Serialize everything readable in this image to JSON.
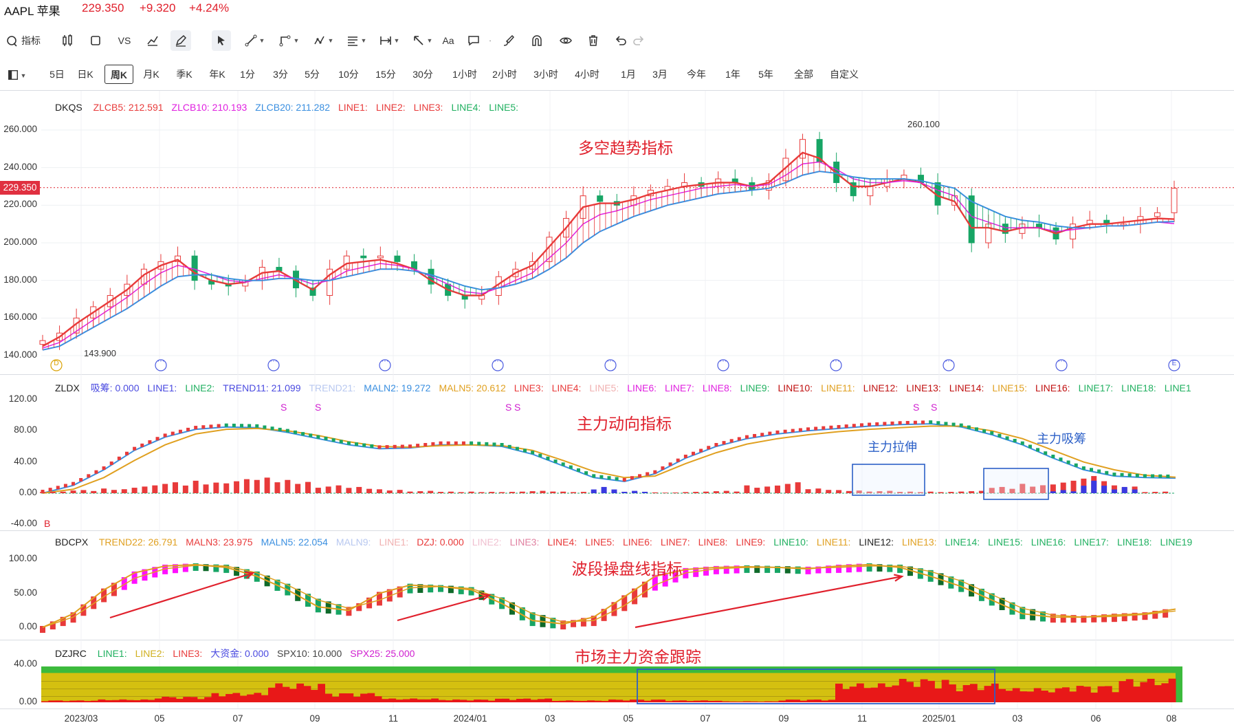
{
  "header": {
    "symbol": "AAPL 苹果",
    "price": "229.350",
    "change": "+9.320",
    "change_pct": "+4.24%",
    "up_color": "#e0202c"
  },
  "toolbar": {
    "indicator_label": "指标",
    "vs_label": "VS",
    "text_tool_label": "Aa",
    "tools": [
      "indicator-icon",
      "bar-chart-icon",
      "rectangle-icon",
      "vs",
      "compare-chart-icon",
      "pen-icon",
      "cursor-icon",
      "line-tool-icon",
      "shape-tool-icon",
      "pattern-tool-icon",
      "text-tool-icon",
      "measure-tool-icon",
      "arrow-tool-icon",
      "text-tool",
      "comment-icon",
      "brush-icon",
      "magnet-icon",
      "eye-icon",
      "trash-icon",
      "undo-icon",
      "redo-icon"
    ]
  },
  "periods": [
    "5日",
    "日K",
    "周K",
    "月K",
    "季K",
    "年K",
    "1分",
    "3分",
    "5分",
    "10分",
    "15分",
    "30分",
    "1小时",
    "2小时",
    "3小时",
    "4小时",
    "1月",
    "3月",
    "今年",
    "1年",
    "5年",
    "全部",
    "自定义"
  ],
  "selected_period": "周K",
  "main_panel": {
    "indicator_name": "DKQS",
    "legend": [
      {
        "text": "ZLCB5: 212.591",
        "color": "#e83a3a"
      },
      {
        "text": "ZLCB10: 210.193",
        "color": "#e020e0"
      },
      {
        "text": "ZLCB20: 211.282",
        "color": "#3a8fe0"
      },
      {
        "text": "LINE1:",
        "color": "#e83a3a"
      },
      {
        "text": "LINE2:",
        "color": "#e83a3a"
      },
      {
        "text": "LINE3:",
        "color": "#e83a3a"
      },
      {
        "text": "LINE4:",
        "color": "#20b060"
      },
      {
        "text": "LINE5:",
        "color": "#20b060"
      }
    ],
    "title": "多空趋势指标",
    "yticks": [
      "260.000",
      "240.000",
      "220.000",
      "200.000",
      "180.000",
      "160.000",
      "140.000"
    ],
    "last_price": "229.350",
    "high_label": "260.100",
    "low_label": "143.900",
    "event_markers": [
      "D",
      "···",
      "···",
      "···",
      "···",
      "···",
      "···",
      "···",
      "···",
      "···",
      "E"
    ]
  },
  "zldx_panel": {
    "indicator_name": "ZLDX",
    "legend": [
      {
        "text": "吸筹: 0.000",
        "color": "#4a4ae0"
      },
      {
        "text": "LINE1:",
        "color": "#4a4ae0"
      },
      {
        "text": "LINE2:",
        "color": "#20b060"
      },
      {
        "text": "TREND11: 21.099",
        "color": "#4a4ae0"
      },
      {
        "text": "TREND21:",
        "color": "#b8c8f0"
      },
      {
        "text": "MALN2: 19.272",
        "color": "#3a8fe0"
      },
      {
        "text": "MALN5: 20.612",
        "color": "#e0a020"
      },
      {
        "text": "LINE3:",
        "color": "#e83a3a"
      },
      {
        "text": "LINE4:",
        "color": "#e83a3a"
      },
      {
        "text": "LINE5:",
        "color": "#f0b0b0"
      },
      {
        "text": "LINE6:",
        "color": "#e020e0"
      },
      {
        "text": "LINE7:",
        "color": "#e020e0"
      },
      {
        "text": "LINE8:",
        "color": "#e020e0"
      },
      {
        "text": "LINE9:",
        "color": "#20b060"
      },
      {
        "text": "LINE10:",
        "color": "#c01010"
      },
      {
        "text": "LINE11:",
        "color": "#e0a020"
      },
      {
        "text": "LINE12:",
        "color": "#c01010"
      },
      {
        "text": "LINE13:",
        "color": "#c01010"
      },
      {
        "text": "LINE14:",
        "color": "#c01010"
      },
      {
        "text": "LINE15:",
        "color": "#e0a020"
      },
      {
        "text": "LINE16:",
        "color": "#c01010"
      },
      {
        "text": "LINE17:",
        "color": "#20b060"
      },
      {
        "text": "LINE18:",
        "color": "#20b060"
      },
      {
        "text": "LINE1",
        "color": "#20b060"
      }
    ],
    "title": "主力动向指标",
    "yticks": [
      "120.00",
      "80.00",
      "40.00",
      "0.00",
      "-40.00"
    ],
    "b_marker": "B",
    "s_markers": [
      "S",
      "S",
      "S",
      "S",
      "S",
      "S"
    ],
    "annot_pull": "主力拉伸",
    "annot_absorb": "主力吸筹"
  },
  "bdcpx_panel": {
    "indicator_name": "BDCPX",
    "legend": [
      {
        "text": "TREND22: 26.791",
        "color": "#e0a020"
      },
      {
        "text": "MALN3: 23.975",
        "color": "#e83a3a"
      },
      {
        "text": "MALN5: 22.054",
        "color": "#3a8fe0"
      },
      {
        "text": "MALN9:",
        "color": "#b8c8f0"
      },
      {
        "text": "LINE1:",
        "color": "#f0b0b0"
      },
      {
        "text": "DZJ: 0.000",
        "color": "#e83a3a"
      },
      {
        "text": "LINE2:",
        "color": "#f0c0d0"
      },
      {
        "text": "LINE3:",
        "color": "#e080a0"
      },
      {
        "text": "LINE4:",
        "color": "#e83a3a"
      },
      {
        "text": "LINE5:",
        "color": "#e83a3a"
      },
      {
        "text": "LINE6:",
        "color": "#e83a3a"
      },
      {
        "text": "LINE7:",
        "color": "#e83a3a"
      },
      {
        "text": "LINE8:",
        "color": "#e83a3a"
      },
      {
        "text": "LINE9:",
        "color": "#e83a3a"
      },
      {
        "text": "LINE10:",
        "color": "#20b060"
      },
      {
        "text": "LINE11:",
        "color": "#e0a020"
      },
      {
        "text": "LINE12:",
        "color": "#222222"
      },
      {
        "text": "LINE13:",
        "color": "#e0a020"
      },
      {
        "text": "LINE14:",
        "color": "#20b060"
      },
      {
        "text": "LINE15:",
        "color": "#20b060"
      },
      {
        "text": "LINE16:",
        "color": "#20b060"
      },
      {
        "text": "LINE17:",
        "color": "#20b060"
      },
      {
        "text": "LINE18:",
        "color": "#20b060"
      },
      {
        "text": "LINE19",
        "color": "#20b060"
      }
    ],
    "title": "波段操盘线指标",
    "yticks": [
      "100.00",
      "50.00",
      "0.00"
    ]
  },
  "dzjrc_panel": {
    "indicator_name": "DZJRC",
    "legend": [
      {
        "text": "LINE1:",
        "color": "#20b060"
      },
      {
        "text": "LINE2:",
        "color": "#d0b020"
      },
      {
        "text": "LINE3:",
        "color": "#e83a3a"
      },
      {
        "text": "大资金: 0.000",
        "color": "#4a4ae0"
      },
      {
        "text": "SPX10: 10.000",
        "color": "#444444"
      },
      {
        "text": "SPX25: 25.000",
        "color": "#d020d0"
      }
    ],
    "title": "市场主力资金跟踪",
    "yticks": [
      "40.00",
      "0.00"
    ]
  },
  "xaxis": [
    "2023/03",
    "05",
    "07",
    "09",
    "11",
    "2024/01",
    "03",
    "05",
    "07",
    "09",
    "11",
    "2025/01",
    "03",
    "06",
    "08"
  ],
  "chart_data": [
    {
      "type": "candlestick",
      "title": "多空趋势指标",
      "ylim": [
        140,
        265
      ],
      "y_high_marked": 260.1,
      "y_low_marked": 143.9,
      "last": 229.35,
      "x": [
        "2023/03",
        "05",
        "07",
        "09",
        "11",
        "2024/01",
        "03",
        "05",
        "07",
        "09",
        "11",
        "2025/01",
        "03",
        "06",
        "08"
      ],
      "close_path": [
        148,
        152,
        160,
        166,
        172,
        178,
        186,
        190,
        193,
        180,
        178,
        177,
        180,
        187,
        185,
        176,
        172,
        186,
        193,
        192,
        193,
        190,
        186,
        178,
        172,
        170,
        172,
        182,
        186,
        190,
        203,
        213,
        225,
        222,
        220,
        225,
        228,
        230,
        232,
        230,
        234,
        232,
        228,
        233,
        245,
        255,
        243,
        232,
        225,
        230,
        234,
        236,
        232,
        220,
        225,
        200,
        210,
        205,
        210,
        208,
        202,
        210,
        212,
        210,
        210,
        214,
        216,
        229
      ],
      "series": [
        {
          "name": "ZLCB5",
          "values": [
            145,
            150,
            157,
            163,
            169,
            175,
            183,
            188,
            191,
            184,
            180,
            178,
            179,
            184,
            185,
            180,
            175,
            183,
            189,
            190,
            191,
            189,
            186,
            180,
            175,
            172,
            172,
            178,
            184,
            188,
            198,
            208,
            219,
            221,
            221,
            223,
            226,
            228,
            230,
            231,
            232,
            232,
            230,
            232,
            240,
            248,
            245,
            237,
            230,
            230,
            232,
            234,
            232,
            225,
            222,
            208,
            208,
            206,
            208,
            208,
            205,
            208,
            210,
            210,
            211,
            212,
            213,
            212.6
          ]
        },
        {
          "name": "ZLCB10",
          "values": [
            144,
            147,
            153,
            159,
            165,
            171,
            178,
            184,
            188,
            186,
            183,
            180,
            179,
            181,
            183,
            181,
            178,
            180,
            185,
            187,
            189,
            188,
            186,
            182,
            178,
            174,
            173,
            176,
            180,
            184,
            192,
            200,
            210,
            215,
            217,
            220,
            223,
            225,
            227,
            229,
            230,
            231,
            230,
            231,
            236,
            242,
            243,
            239,
            234,
            232,
            232,
            233,
            232,
            228,
            225,
            214,
            211,
            208,
            208,
            208,
            206,
            207,
            208,
            209,
            209,
            210,
            211,
            210.2
          ]
        },
        {
          "name": "ZLCB20",
          "values": [
            143,
            145,
            150,
            155,
            160,
            165,
            171,
            177,
            182,
            183,
            183,
            181,
            180,
            180,
            181,
            181,
            180,
            180,
            182,
            184,
            186,
            186,
            185,
            183,
            180,
            177,
            175,
            176,
            178,
            181,
            186,
            192,
            200,
            206,
            210,
            214,
            217,
            220,
            222,
            224,
            226,
            227,
            228,
            229,
            232,
            236,
            238,
            237,
            235,
            234,
            234,
            234,
            233,
            231,
            229,
            222,
            218,
            214,
            212,
            211,
            209,
            208,
            208,
            209,
            209,
            210,
            211,
            211.3
          ]
        }
      ]
    },
    {
      "type": "line",
      "title": "主力动向指标",
      "ylim": [
        -40,
        120
      ],
      "x": [
        "2023/03",
        "05",
        "07",
        "09",
        "11",
        "2024/01",
        "03",
        "05",
        "07",
        "09",
        "11",
        "2025/01",
        "03",
        "06",
        "08"
      ],
      "series": [
        {
          "name": "MALN2",
          "values": [
            0,
            10,
            30,
            55,
            72,
            82,
            85,
            84,
            78,
            70,
            62,
            57,
            58,
            62,
            62,
            60,
            50,
            35,
            20,
            15,
            25,
            45,
            60,
            70,
            76,
            80,
            83,
            86,
            88,
            89,
            85,
            75,
            62,
            45,
            30,
            22,
            20,
            19.3
          ]
        },
        {
          "name": "MALN5",
          "values": [
            0,
            5,
            20,
            42,
            62,
            76,
            82,
            83,
            80,
            74,
            66,
            60,
            59,
            61,
            62,
            61,
            55,
            42,
            28,
            20,
            22,
            38,
            52,
            63,
            70,
            75,
            79,
            82,
            84,
            86,
            86,
            80,
            70,
            55,
            40,
            30,
            23,
            20.6
          ]
        }
      ],
      "bars_red": [
        2,
        4,
        6,
        10,
        14,
        16,
        18,
        20,
        17,
        10,
        8,
        5,
        3,
        2,
        2,
        2,
        3,
        2,
        2,
        2,
        1,
        2,
        3,
        10,
        14,
        6,
        4,
        3,
        2,
        2,
        3,
        8,
        12,
        16,
        22,
        10,
        2,
        0
      ],
      "bars_blue": [
        0,
        0,
        0,
        0,
        0,
        0,
        0,
        0,
        0,
        0,
        0,
        0,
        0,
        0,
        0,
        0,
        0,
        0,
        8,
        3,
        0,
        0,
        0,
        0,
        0,
        0,
        0,
        0,
        0,
        0,
        0,
        0,
        0,
        4,
        16,
        8,
        0,
        0
      ]
    },
    {
      "type": "line",
      "title": "波段操盘线指标",
      "ylim": [
        -10,
        105
      ],
      "x": [
        "2023/03",
        "05",
        "07",
        "09",
        "11",
        "2024/01",
        "03",
        "05",
        "07",
        "09",
        "11",
        "2025/01",
        "03",
        "06",
        "08"
      ],
      "series": [
        {
          "name": "TREND22",
          "values": [
            0,
            20,
            55,
            80,
            90,
            92,
            88,
            75,
            55,
            30,
            25,
            50,
            62,
            60,
            55,
            35,
            10,
            5,
            15,
            45,
            75,
            85,
            88,
            89,
            88,
            86,
            90,
            92,
            88,
            75,
            60,
            40,
            20,
            15,
            15,
            18,
            20,
            26.8
          ]
        },
        {
          "name": "MALN3",
          "values": [
            0,
            15,
            45,
            72,
            86,
            91,
            90,
            80,
            62,
            40,
            28,
            40,
            58,
            60,
            57,
            42,
            20,
            8,
            10,
            32,
            62,
            80,
            86,
            88,
            88,
            87,
            88,
            90,
            90,
            82,
            68,
            48,
            28,
            18,
            15,
            16,
            19,
            24
          ]
        }
      ]
    },
    {
      "type": "bar",
      "title": "市场主力资金跟踪",
      "ylim": [
        0,
        45
      ],
      "x": [
        "2023/03",
        "05",
        "07",
        "09",
        "11",
        "2024/01",
        "03",
        "05",
        "07",
        "09",
        "11",
        "2025/01",
        "03",
        "06",
        "08"
      ],
      "series": [
        {
          "name": "LINE1",
          "values": [
            35,
            35,
            35,
            35,
            35,
            35,
            35,
            35,
            35,
            35,
            35,
            35,
            35,
            35,
            35,
            35,
            35,
            35,
            35,
            35
          ]
        },
        {
          "name": "LINE3",
          "values": [
            2,
            3,
            6,
            10,
            20,
            10,
            4,
            3,
            4,
            2,
            3,
            2,
            1,
            3,
            20,
            25,
            20,
            15,
            18,
            25
          ]
        }
      ]
    }
  ]
}
